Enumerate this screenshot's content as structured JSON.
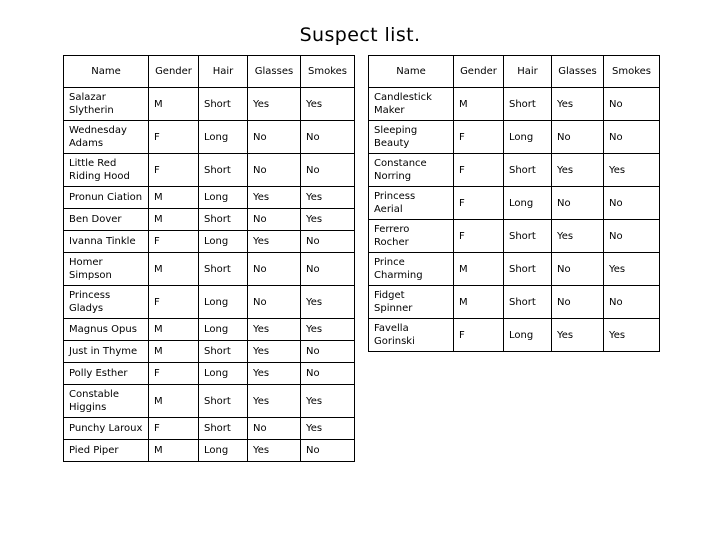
{
  "slide": {
    "title": "Suspect list."
  },
  "columns": [
    "Name",
    "Gender",
    "Hair",
    "Glasses",
    "Smokes"
  ],
  "tables": [
    {
      "id": "left",
      "name": "suspect-table-left",
      "headers": [
        "Name",
        "Gender",
        "Hair",
        "Glasses",
        "Smokes"
      ],
      "rows": [
        {
          "name": "Salazar Slytherin",
          "name_lines": [
            "Salazar",
            "Slytherin"
          ],
          "gender": "M",
          "hair": "Short",
          "glasses": "Yes",
          "smokes": "Yes"
        },
        {
          "name": "Wednesday Adams",
          "name_lines": [
            "Wednesday",
            "Adams"
          ],
          "gender": "F",
          "hair": "Long",
          "glasses": "No",
          "smokes": "No"
        },
        {
          "name": "Little Red Riding Hood",
          "name_lines": [
            "Little Red",
            "Riding Hood"
          ],
          "gender": "F",
          "hair": "Short",
          "glasses": "No",
          "smokes": "No"
        },
        {
          "name": "Pronun Ciation",
          "name_lines": [
            "Pronun Ciation"
          ],
          "gender": "M",
          "hair": "Long",
          "glasses": "Yes",
          "smokes": "Yes"
        },
        {
          "name": "Ben Dover",
          "name_lines": [
            "Ben Dover"
          ],
          "gender": "M",
          "hair": "Short",
          "glasses": "No",
          "smokes": "Yes"
        },
        {
          "name": "Ivanna Tinkle",
          "name_lines": [
            "Ivanna Tinkle"
          ],
          "gender": "F",
          "hair": "Long",
          "glasses": "Yes",
          "smokes": "No"
        },
        {
          "name": "Homer Simpson",
          "name_lines": [
            "Homer",
            "Simpson"
          ],
          "gender": "M",
          "hair": "Short",
          "glasses": "No",
          "smokes": "No"
        },
        {
          "name": "Princess Gladys",
          "name_lines": [
            "Princess",
            "Gladys"
          ],
          "gender": "F",
          "hair": "Long",
          "glasses": "No",
          "smokes": "Yes"
        },
        {
          "name": "Magnus Opus",
          "name_lines": [
            "Magnus Opus"
          ],
          "gender": "M",
          "hair": "Long",
          "glasses": "Yes",
          "smokes": "Yes"
        },
        {
          "name": "Just in Thyme",
          "name_lines": [
            "Just in Thyme"
          ],
          "gender": "M",
          "hair": "Short",
          "glasses": "Yes",
          "smokes": "No"
        },
        {
          "name": "Polly Esther",
          "name_lines": [
            "Polly Esther"
          ],
          "gender": "F",
          "hair": "Long",
          "glasses": "Yes",
          "smokes": "No"
        },
        {
          "name": "Constable Higgins",
          "name_lines": [
            "Constable",
            "Higgins"
          ],
          "gender": "M",
          "hair": "Short",
          "glasses": "Yes",
          "smokes": "Yes"
        },
        {
          "name": "Punchy Laroux",
          "name_lines": [
            "Punchy Laroux"
          ],
          "gender": "F",
          "hair": "Short",
          "glasses": "No",
          "smokes": "Yes"
        },
        {
          "name": "Pied Piper",
          "name_lines": [
            "Pied Piper"
          ],
          "gender": "M",
          "hair": "Long",
          "glasses": "Yes",
          "smokes": "No"
        }
      ]
    },
    {
      "id": "right",
      "name": "suspect-table-right",
      "headers": [
        "Name",
        "Gender",
        "Hair",
        "Glasses",
        "Smokes"
      ],
      "rows": [
        {
          "name": "Candlestick Maker",
          "name_lines": [
            "Candlestick",
            "Maker"
          ],
          "gender": "M",
          "hair": "Short",
          "glasses": "Yes",
          "smokes": "No"
        },
        {
          "name": "Sleeping Beauty",
          "name_lines": [
            "Sleeping",
            "Beauty"
          ],
          "gender": "F",
          "hair": "Long",
          "glasses": "No",
          "smokes": "No"
        },
        {
          "name": "Constance Norring",
          "name_lines": [
            "Constance",
            "Norring"
          ],
          "gender": "F",
          "hair": "Short",
          "glasses": "Yes",
          "smokes": "Yes"
        },
        {
          "name": "Princess Aerial",
          "name_lines": [
            "Princess",
            "Aerial"
          ],
          "gender": "F",
          "hair": "Long",
          "glasses": "No",
          "smokes": "No"
        },
        {
          "name": "Ferrero Rocher",
          "name_lines": [
            "Ferrero",
            "Rocher"
          ],
          "gender": "F",
          "hair": "Short",
          "glasses": "Yes",
          "smokes": "No"
        },
        {
          "name": "Prince Charming",
          "name_lines": [
            "Prince",
            "Charming"
          ],
          "gender": "M",
          "hair": "Short",
          "glasses": "No",
          "smokes": "Yes"
        },
        {
          "name": "Fidget Spinner",
          "name_lines": [
            "Fidget",
            "Spinner"
          ],
          "gender": "M",
          "hair": "Short",
          "glasses": "No",
          "smokes": "No"
        },
        {
          "name": "Favella Gorinski",
          "name_lines": [
            "Favella",
            "Gorinski"
          ],
          "gender": "F",
          "hair": "Long",
          "glasses": "Yes",
          "smokes": "Yes"
        }
      ]
    }
  ]
}
